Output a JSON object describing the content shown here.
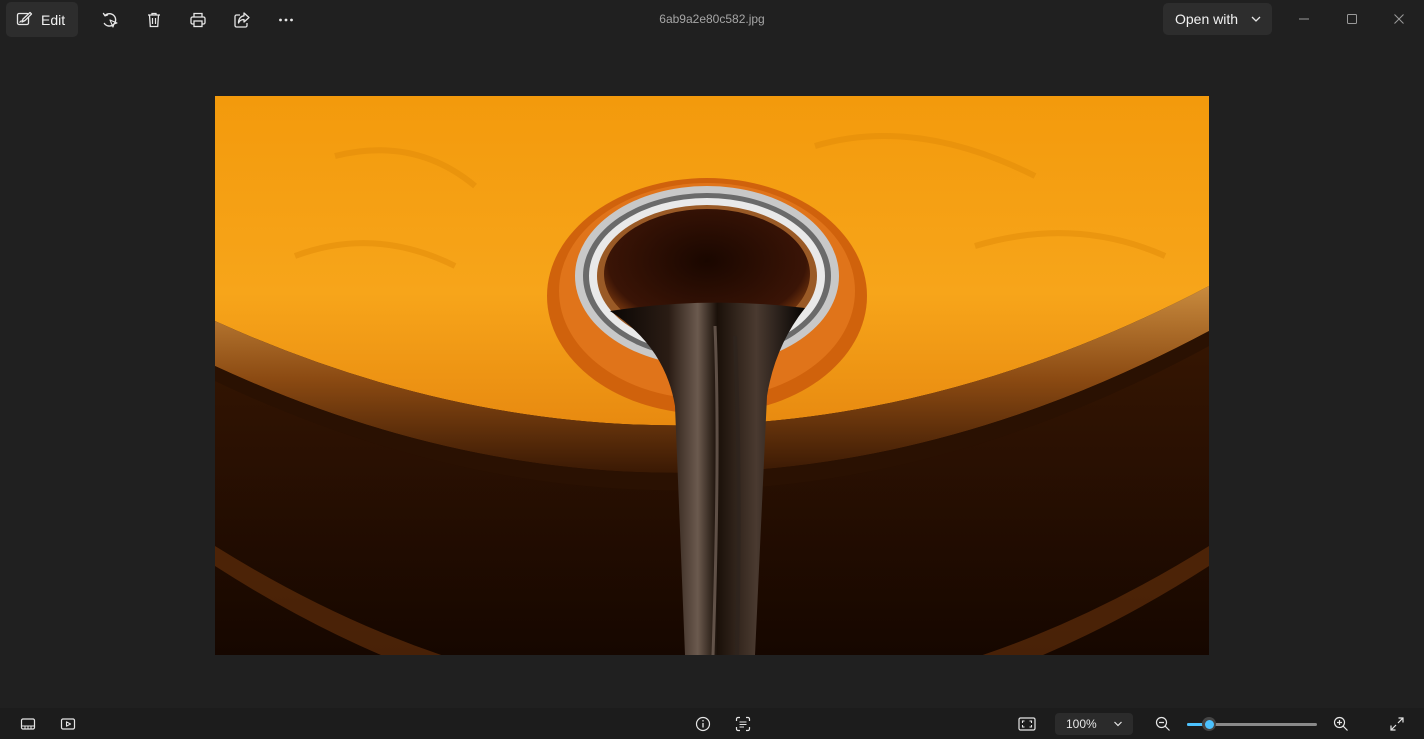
{
  "toolbar": {
    "edit_label": "Edit",
    "filename": "6ab9a2e80c582.jpg",
    "open_with_label": "Open with"
  },
  "footer": {
    "zoom_value": "100%",
    "zoom_slider_fraction": 0.17
  },
  "icons": {
    "edit": "edit-icon",
    "rotate": "rotate-icon",
    "delete": "trash-icon",
    "print": "print-icon",
    "share": "share-icon",
    "more": "more-icon",
    "minimize": "minimize-icon",
    "maximize": "maximize-icon",
    "close": "close-icon",
    "filmstrip": "filmstrip-icon",
    "slideshow": "slideshow-icon",
    "info": "info-icon",
    "scan_text": "scan-text-icon",
    "fit": "fit-to-window-icon",
    "zoom_out": "zoom-out-icon",
    "zoom_in": "zoom-in-icon",
    "fullscreen": "fullscreen-icon"
  },
  "colors": {
    "background": "#202020",
    "accent": "#4cc2ff",
    "button_bg": "#2d2d2d"
  }
}
